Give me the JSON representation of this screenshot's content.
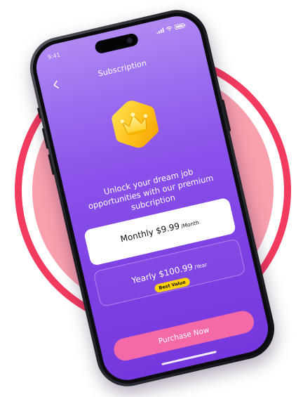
{
  "status_bar": {
    "time": "9:41",
    "icons": [
      "signal-icon",
      "wifi-icon",
      "battery-icon"
    ]
  },
  "header": {
    "title": "Subscription",
    "back_icon": "chevron-left-icon"
  },
  "hero": {
    "icon": "crown-icon",
    "headline": "Unlock your dream job opportunities with our premium subcription"
  },
  "plans": [
    {
      "name": "Monthly",
      "price": "$9.99",
      "period": "/Month",
      "selected": true
    },
    {
      "name": "Yearly",
      "price": "$100.99",
      "period": "/Year",
      "selected": false,
      "badge": "Best Value"
    }
  ],
  "cta": {
    "label": "Purchase Now"
  },
  "colors": {
    "ring_outer": "#f23b5e",
    "ring_inner": "#f9a0ad",
    "screen_top": "#b189f2",
    "screen_bottom": "#7438de",
    "badge": "#ffd30a",
    "cta": "#f46aa8"
  }
}
